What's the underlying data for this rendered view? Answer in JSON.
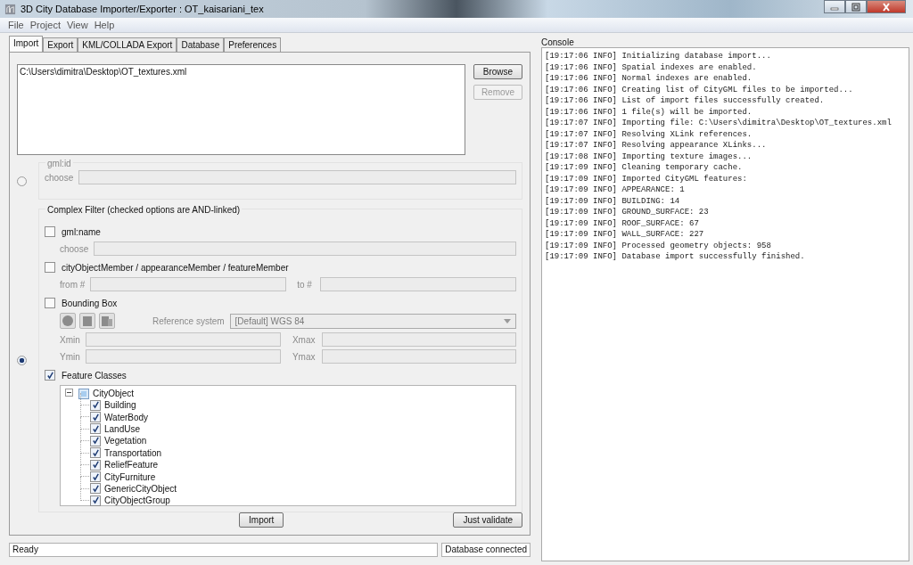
{
  "window": {
    "title": "3D City Database Importer/Exporter : OT_kaisariani_tex"
  },
  "menu": [
    "File",
    "Project",
    "View",
    "Help"
  ],
  "tabs": [
    {
      "label": "Import",
      "selected": true
    },
    {
      "label": "Export",
      "selected": false
    },
    {
      "label": "KML/COLLADA Export",
      "selected": false
    },
    {
      "label": "Database",
      "selected": false
    },
    {
      "label": "Preferences",
      "selected": false
    }
  ],
  "import_files": [
    "C:\\Users\\dimitra\\Desktop\\OT_textures.xml"
  ],
  "file_buttons": [
    {
      "label": "Browse",
      "disabled": false
    },
    {
      "label": "Remove",
      "disabled": true
    }
  ],
  "gml_id_filter": {
    "selected": false,
    "title": "gml:id",
    "field_label": "choose"
  },
  "complex_filter": {
    "selected": true,
    "title": "Complex Filter (checked options are AND-linked)",
    "filters": [
      {
        "kind": "text",
        "label": "gml:name",
        "checked": false,
        "field_label": "choose"
      },
      {
        "kind": "range",
        "label": "cityObjectMember / appearanceMember / featureMember",
        "checked": false,
        "from_label": "from #",
        "to_label": "to #"
      },
      {
        "kind": "bbox",
        "label": "Bounding Box",
        "checked": false,
        "reference_label": "Reference system",
        "reference_value": "[Default] WGS 84",
        "coords": [
          "Xmin",
          "Xmax",
          "Ymin",
          "Ymax"
        ]
      },
      {
        "kind": "tree",
        "label": "Feature Classes",
        "checked": true,
        "tree": {
          "label": "CityObject",
          "expanded": true,
          "children": [
            {
              "label": "Building",
              "checked": true
            },
            {
              "label": "WaterBody",
              "checked": true
            },
            {
              "label": "LandUse",
              "checked": true
            },
            {
              "label": "Vegetation",
              "checked": true
            },
            {
              "label": "Transportation",
              "checked": true
            },
            {
              "label": "ReliefFeature",
              "checked": true
            },
            {
              "label": "CityFurniture",
              "checked": true
            },
            {
              "label": "GenericCityObject",
              "checked": true
            },
            {
              "label": "CityObjectGroup",
              "checked": true
            }
          ]
        }
      }
    ]
  },
  "action_buttons": [
    "Import",
    "Just validate"
  ],
  "status_bar": {
    "message": "Ready",
    "connection": "Database connected"
  },
  "console": {
    "title": "Console",
    "lines": [
      "[19:17:06 INFO] Initializing database import...",
      "[19:17:06 INFO] Spatial indexes are enabled.",
      "[19:17:06 INFO] Normal indexes are enabled.",
      "[19:17:06 INFO] Creating list of CityGML files to be imported...",
      "[19:17:06 INFO] List of import files successfully created.",
      "[19:17:06 INFO] 1 file(s) will be imported.",
      "[19:17:07 INFO] Importing file: C:\\Users\\dimitra\\Desktop\\OT_textures.xml",
      "[19:17:07 INFO] Resolving XLink references.",
      "[19:17:07 INFO] Resolving appearance XLinks...",
      "[19:17:08 INFO] Importing texture images...",
      "[19:17:09 INFO] Cleaning temporary cache.",
      "[19:17:09 INFO] Imported CityGML features:",
      "[19:17:09 INFO] APPEARANCE: 1",
      "[19:17:09 INFO] BUILDING: 14",
      "[19:17:09 INFO] GROUND_SURFACE: 23",
      "[19:17:09 INFO] ROOF_SURFACE: 67",
      "[19:17:09 INFO] WALL_SURFACE: 227",
      "[19:17:09 INFO] Processed geometry objects: 958",
      "[19:17:09 INFO] Database import successfully finished."
    ]
  }
}
